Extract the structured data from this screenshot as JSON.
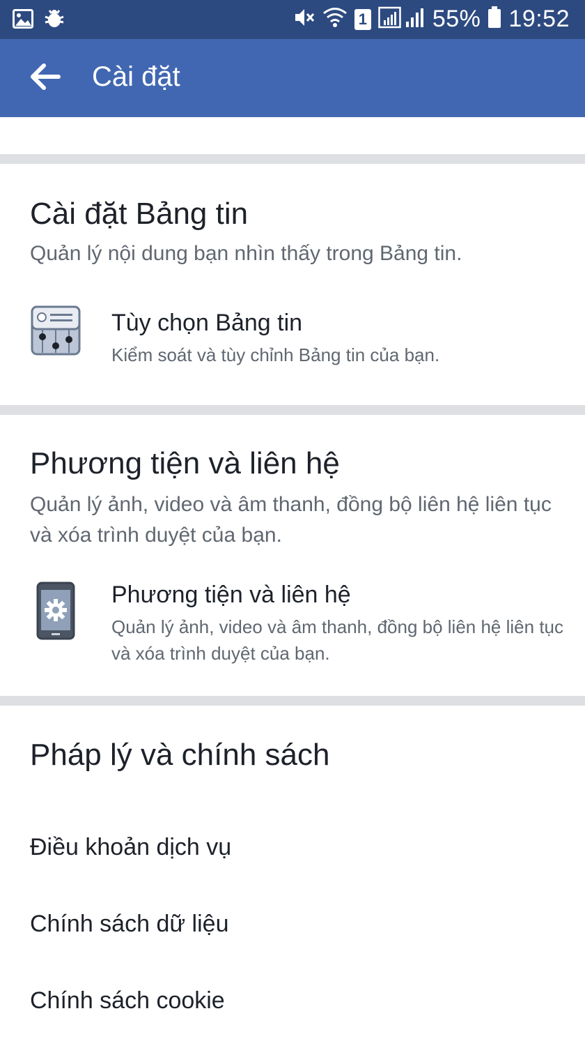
{
  "status_bar": {
    "battery": "55%",
    "time": "19:52",
    "sim_badge": "1",
    "icons": [
      "gallery-icon",
      "bug-icon",
      "mute-icon",
      "wifi-icon",
      "signal-icon",
      "battery-icon"
    ]
  },
  "app_bar": {
    "title": "Cài đặt",
    "back_icon": "back-arrow-icon",
    "color": "#4267b2"
  },
  "news_feed_section": {
    "title": "Cài đặt Bảng tin",
    "description": "Quản lý nội dung bạn nhìn thấy trong Bảng tin.",
    "item": {
      "icon": "news-feed-preferences-icon",
      "title": "Tùy chọn Bảng tin",
      "description": "Kiểm soát và tùy chỉnh Bảng tin của bạn."
    }
  },
  "media_section": {
    "title": "Phương tiện và liên hệ",
    "description": "Quản lý ảnh, video và âm thanh, đồng bộ liên hệ liên tục và xóa trình duyệt của bạn.",
    "item": {
      "icon": "phone-settings-icon",
      "title": "Phương tiện và liên hệ",
      "description": "Quản lý ảnh, video và âm thanh, đồng bộ liên hệ liên tục và xóa trình duyệt của bạn."
    }
  },
  "legal_section": {
    "title": "Pháp lý và chính sách",
    "links": [
      "Điều khoản dịch vụ",
      "Chính sách dữ liệu",
      "Chính sách cookie"
    ]
  }
}
